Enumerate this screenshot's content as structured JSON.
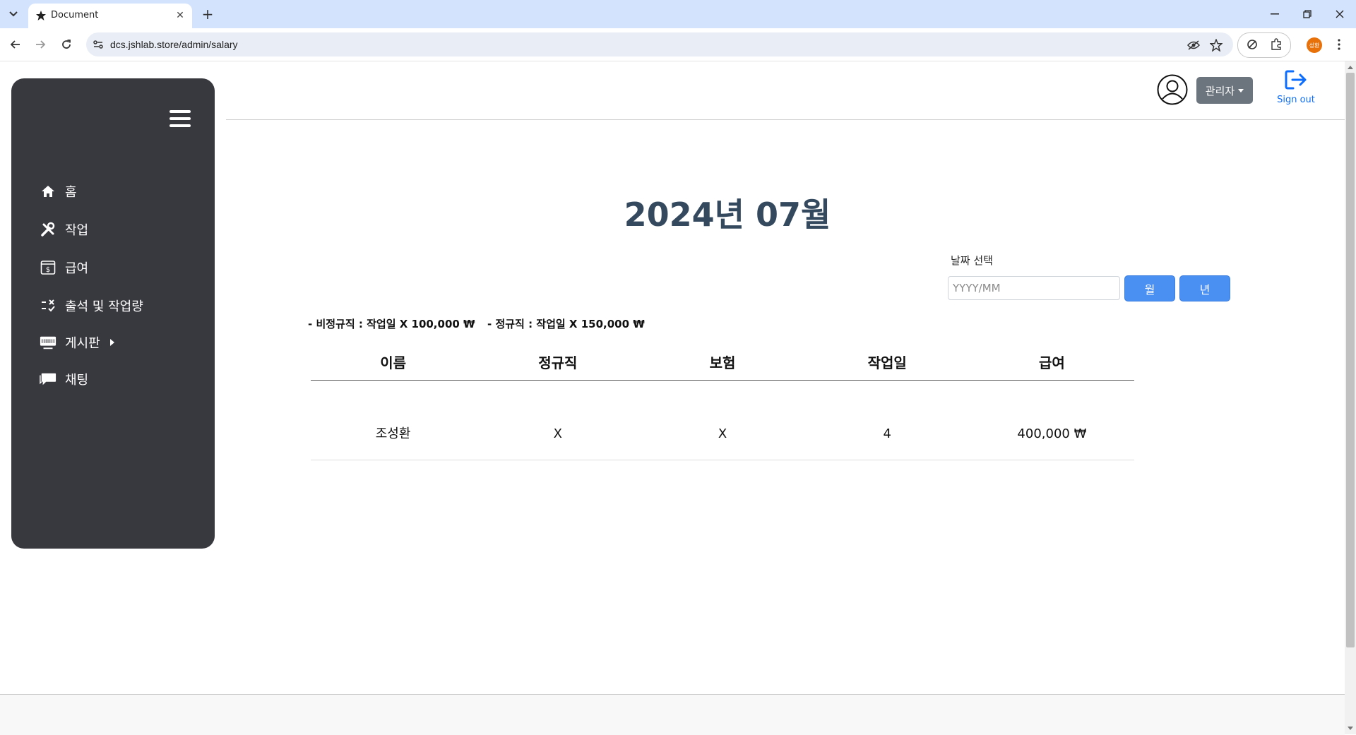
{
  "browser": {
    "tab_title": "Document",
    "url": "dcs.jshlab.store/admin/salary",
    "profile_initials": "성환"
  },
  "sidebar": {
    "items": [
      {
        "label": "홈",
        "icon": "home-icon"
      },
      {
        "label": "작업",
        "icon": "tools-icon"
      },
      {
        "label": "급여",
        "icon": "salary-icon"
      },
      {
        "label": "출석 및 작업량",
        "icon": "attendance-icon"
      },
      {
        "label": "게시판",
        "icon": "board-icon"
      },
      {
        "label": "채팅",
        "icon": "chat-icon"
      }
    ]
  },
  "header": {
    "role_label": "관리자",
    "signout_label": "Sign out"
  },
  "main": {
    "title": "2024년 07월",
    "date_picker": {
      "label": "날짜 선택",
      "placeholder": "YYYY/MM",
      "month_button": "월",
      "year_button": "년"
    },
    "rates": [
      "-  비정규직 : 작업일 X 100,000 ₩",
      "-  정규직 : 작업일 X 150,000 ₩"
    ],
    "table": {
      "headers": [
        "이름",
        "정규직",
        "보험",
        "작업일",
        "급여"
      ],
      "rows": [
        [
          "조성환",
          "X",
          "X",
          "4",
          "400,000 ₩"
        ]
      ]
    }
  },
  "colors": {
    "sidebar_bg": "#38383f",
    "title_color": "#34495e",
    "button_blue": "#4a8ff2",
    "role_button": "#6c757d",
    "signout_blue": "#0d6efd"
  }
}
